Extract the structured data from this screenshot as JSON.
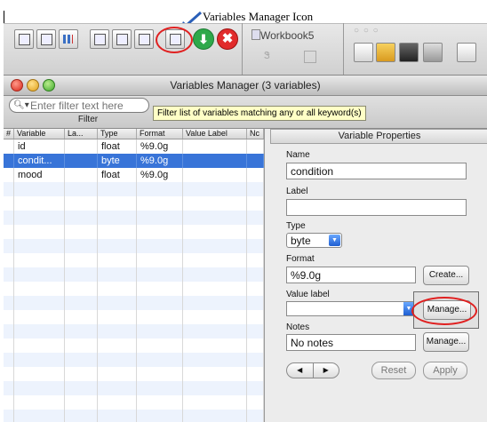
{
  "annotation": {
    "text": "Variables Manager Icon"
  },
  "background_app": {
    "toolbar_icons": [
      "more-icon",
      "log-icon",
      "graph-icon",
      "do-file-editor-icon",
      "data-editor-icon",
      "data-browser-icon",
      "variables-manager-icon",
      "do-icon",
      "break-icon"
    ],
    "workbook_title": "Workbook5",
    "stop_glyph": "✖",
    "go_glyph": "⬇"
  },
  "window": {
    "title": "Variables Manager (3 variables)",
    "filter": {
      "placeholder": "Enter filter text here",
      "label": "Filter",
      "tooltip": "Filter list of variables matching any or all keyword(s)"
    },
    "table": {
      "columns": [
        "#",
        "Variable",
        "La...",
        "Type",
        "Format",
        "Value Label",
        "Nc"
      ],
      "rows": [
        {
          "name": "id",
          "label": "",
          "type": "float",
          "format": "%9.0g",
          "value_label": "",
          "selected": false
        },
        {
          "name": "condit...",
          "label": "",
          "type": "byte",
          "format": "%9.0g",
          "value_label": "",
          "selected": true
        },
        {
          "name": "mood",
          "label": "",
          "type": "float",
          "format": "%9.0g",
          "value_label": "",
          "selected": false
        }
      ]
    },
    "properties": {
      "header": "Variable Properties",
      "name_label": "Name",
      "name_value": "condition",
      "label_label": "Label",
      "label_value": "",
      "type_label": "Type",
      "type_value": "byte",
      "format_label": "Format",
      "format_value": "%9.0g",
      "create_button": "Create...",
      "value_label_label": "Value label",
      "value_label_value": "",
      "manage_button": "Manage...",
      "notes_label": "Notes",
      "notes_value": "No notes",
      "notes_manage_button": "Manage...",
      "prev_glyph": "◀",
      "next_glyph": "▶",
      "reset_button": "Reset",
      "apply_button": "Apply"
    }
  },
  "colors": {
    "selection": "#3874d8",
    "highlight_circle": "#e02020",
    "tooltip_bg": "#ffffc6"
  }
}
